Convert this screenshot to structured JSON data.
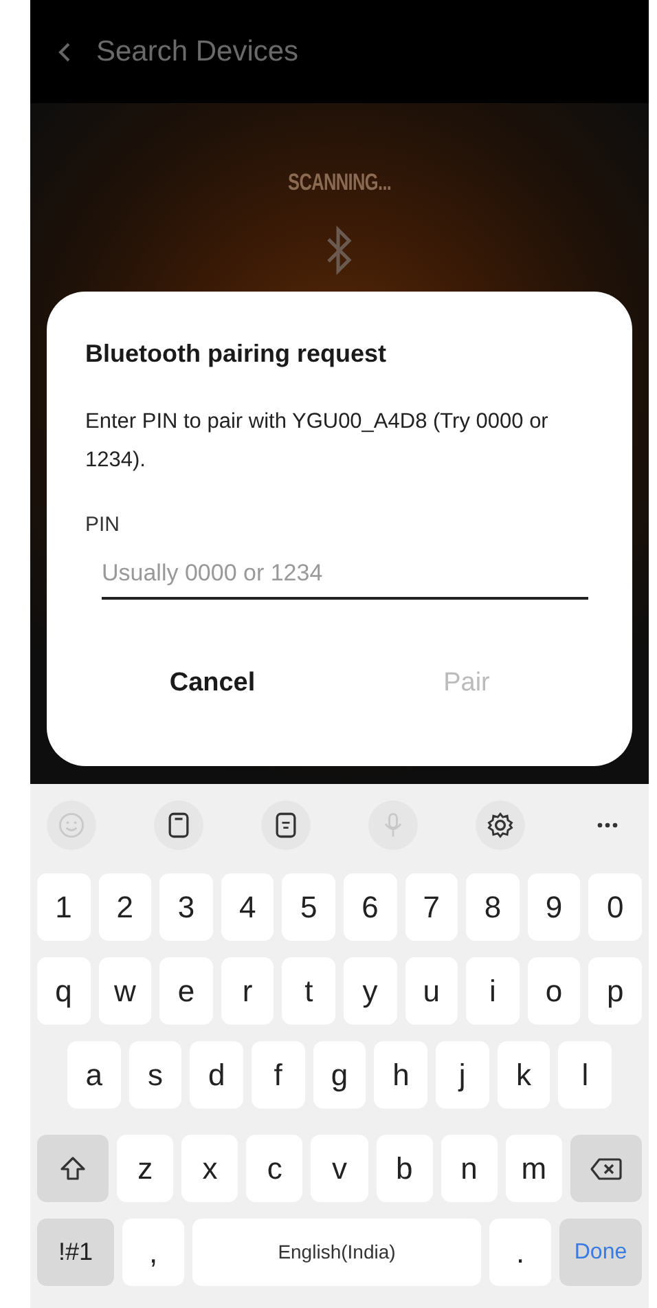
{
  "app_bar": {
    "title": "Search Devices"
  },
  "scanner": {
    "status": "SCANNING..."
  },
  "dialog": {
    "title": "Bluetooth pairing request",
    "message": "Enter PIN to pair with YGU00_A4D8 (Try 0000 or 1234).",
    "field_label": "PIN",
    "placeholder": "Usually 0000 or 1234",
    "buttons": [
      {
        "label": "Cancel",
        "disabled": false
      },
      {
        "label": "Pair",
        "disabled": true
      }
    ]
  },
  "keyboard": {
    "toolbar": [
      {
        "kind": "emoji",
        "disabled": true
      },
      {
        "kind": "clipboard",
        "disabled": false
      },
      {
        "kind": "keyboard",
        "disabled": false
      },
      {
        "kind": "mic",
        "disabled": true
      },
      {
        "kind": "settings",
        "disabled": false
      },
      {
        "kind": "more",
        "disabled": false
      }
    ],
    "key_rows": [
      {
        "keys": [
          {
            "kind": "char",
            "label": "1"
          },
          {
            "kind": "char",
            "label": "2"
          },
          {
            "kind": "char",
            "label": "3"
          },
          {
            "kind": "char",
            "label": "4"
          },
          {
            "kind": "char",
            "label": "5"
          },
          {
            "kind": "char",
            "label": "6"
          },
          {
            "kind": "char",
            "label": "7"
          },
          {
            "kind": "char",
            "label": "8"
          },
          {
            "kind": "char",
            "label": "9"
          },
          {
            "kind": "char",
            "label": "0"
          }
        ]
      },
      {
        "keys": [
          {
            "kind": "char",
            "label": "q"
          },
          {
            "kind": "char",
            "label": "w"
          },
          {
            "kind": "char",
            "label": "e"
          },
          {
            "kind": "char",
            "label": "r"
          },
          {
            "kind": "char",
            "label": "t"
          },
          {
            "kind": "char",
            "label": "y"
          },
          {
            "kind": "char",
            "label": "u"
          },
          {
            "kind": "char",
            "label": "i"
          },
          {
            "kind": "char",
            "label": "o"
          },
          {
            "kind": "char",
            "label": "p"
          }
        ]
      },
      {
        "keys": [
          {
            "kind": "char",
            "label": "a"
          },
          {
            "kind": "char",
            "label": "s"
          },
          {
            "kind": "char",
            "label": "d"
          },
          {
            "kind": "char",
            "label": "f"
          },
          {
            "kind": "char",
            "label": "g"
          },
          {
            "kind": "char",
            "label": "h"
          },
          {
            "kind": "char",
            "label": "j"
          },
          {
            "kind": "char",
            "label": "k"
          },
          {
            "kind": "char",
            "label": "l"
          }
        ]
      },
      {
        "keys": [
          {
            "kind": "shift"
          },
          {
            "kind": "char",
            "label": "z"
          },
          {
            "kind": "char",
            "label": "x"
          },
          {
            "kind": "char",
            "label": "c"
          },
          {
            "kind": "char",
            "label": "v"
          },
          {
            "kind": "char",
            "label": "b"
          },
          {
            "kind": "char",
            "label": "n"
          },
          {
            "kind": "char",
            "label": "m"
          },
          {
            "kind": "backspace"
          }
        ]
      },
      {
        "keys": [
          {
            "kind": "mode",
            "label": "!#1"
          },
          {
            "kind": "char",
            "label": ","
          },
          {
            "kind": "space",
            "label": "English(India)"
          },
          {
            "kind": "char",
            "label": "."
          },
          {
            "kind": "done",
            "label": "Done"
          }
        ]
      }
    ]
  }
}
